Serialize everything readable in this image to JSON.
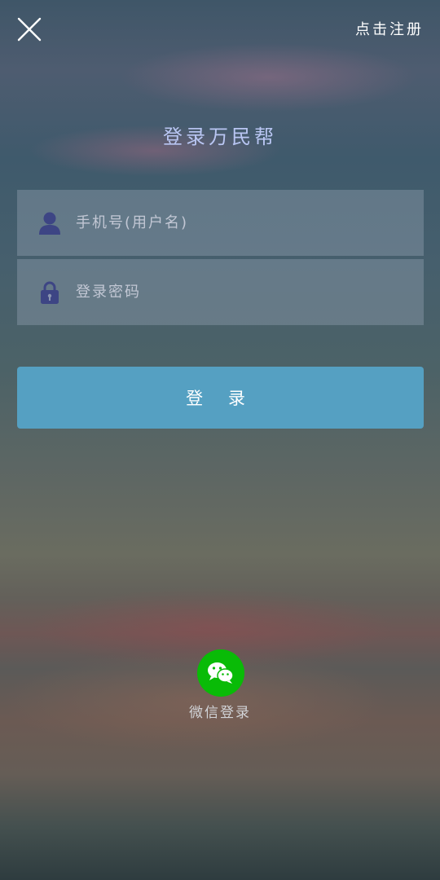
{
  "header": {
    "close_icon": "close-icon",
    "register_label": "点击注册"
  },
  "title": "登录万民帮",
  "form": {
    "username": {
      "icon": "user-icon",
      "value": "",
      "placeholder": "手机号(用户名)"
    },
    "password": {
      "icon": "lock-icon",
      "value": "",
      "placeholder": "登录密码"
    },
    "login_label": "登 录"
  },
  "social": {
    "wechat_icon": "wechat-icon",
    "wechat_label": "微信登录"
  },
  "colors": {
    "title": "#b9c6f3",
    "icon": "#3d4584",
    "login_button": "#55a0c2",
    "wechat": "#09bb07"
  }
}
